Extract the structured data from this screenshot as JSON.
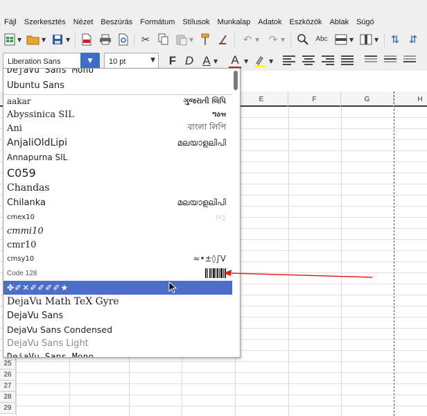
{
  "menubar": {
    "items": [
      "Fájl",
      "Szerkesztés",
      "Nézet",
      "Beszúrás",
      "Formátum",
      "Stílusok",
      "Munkalap",
      "Adatok",
      "Eszközök",
      "Ablak",
      "Súgó"
    ]
  },
  "toolbar": {
    "icons": [
      "new-spreadsheet-icon",
      "open-folder-icon",
      "save-icon",
      "export-pdf-icon",
      "print-icon",
      "print-preview-icon",
      "cut-icon",
      "copy-icon",
      "paste-icon",
      "clone-formatting-icon",
      "clear-formatting-icon",
      "undo-icon",
      "redo-icon",
      "find-replace-icon",
      "spelling-icon",
      "row-icon",
      "column-icon",
      "sort-ascending-icon",
      "sort-descending-icon"
    ]
  },
  "format": {
    "font_name": "Liberation Sans",
    "font_size": "10 pt",
    "bold_label": "F",
    "italic_label": "D",
    "underline_label": "A",
    "font_color_label": "A",
    "font_color": "#c9211e",
    "highlight_color": "#ffff00"
  },
  "sheet": {
    "columns": [
      "E",
      "F",
      "G",
      "H"
    ],
    "rows": [
      "25",
      "26",
      "27",
      "28",
      "29"
    ]
  },
  "font_list": {
    "recent": [
      {
        "name": "DejaVu Sans Mono"
      },
      {
        "name": "Ubuntu Sans"
      }
    ],
    "items": [
      {
        "name": "aakar",
        "preview": "ગુજરાતી લિપિ"
      },
      {
        "name": "Abyssinica SIL",
        "preview": "ግዕዝ"
      },
      {
        "name": "Ani",
        "preview": "বাংলা লিপি"
      },
      {
        "name": "AnjaliOldLipi",
        "preview": "മലയാളലിപി"
      },
      {
        "name": "Annapurna SIL",
        "preview": ""
      },
      {
        "name": "C059",
        "preview": ""
      },
      {
        "name": "Chandas",
        "preview": ""
      },
      {
        "name": "Chilanka",
        "preview": "മലയാളലിപി"
      },
      {
        "name": "cmex10",
        "preview": "∫√∑"
      },
      {
        "name": "cmmi10",
        "preview": ""
      },
      {
        "name": "cmr10",
        "preview": ""
      },
      {
        "name": "cmsy10",
        "preview": "≈•±◊∫V"
      },
      {
        "name": "Code 128",
        "preview": ""
      },
      {
        "name": "✤✐✕✐✐✐✐★",
        "preview": ""
      },
      {
        "name": "DejaVu Math TeX Gyre",
        "preview": ""
      },
      {
        "name": "DejaVu Sans",
        "preview": ""
      },
      {
        "name": "DejaVu Sans Condensed",
        "preview": ""
      },
      {
        "name": "DejaVu Sans Light",
        "preview": ""
      },
      {
        "name": "DejaVu Sans Mono",
        "preview": ""
      }
    ],
    "selected_index": 13,
    "highlight_color": "#4d6ec8"
  },
  "annotation": {
    "arrow_color": "#e02020"
  }
}
